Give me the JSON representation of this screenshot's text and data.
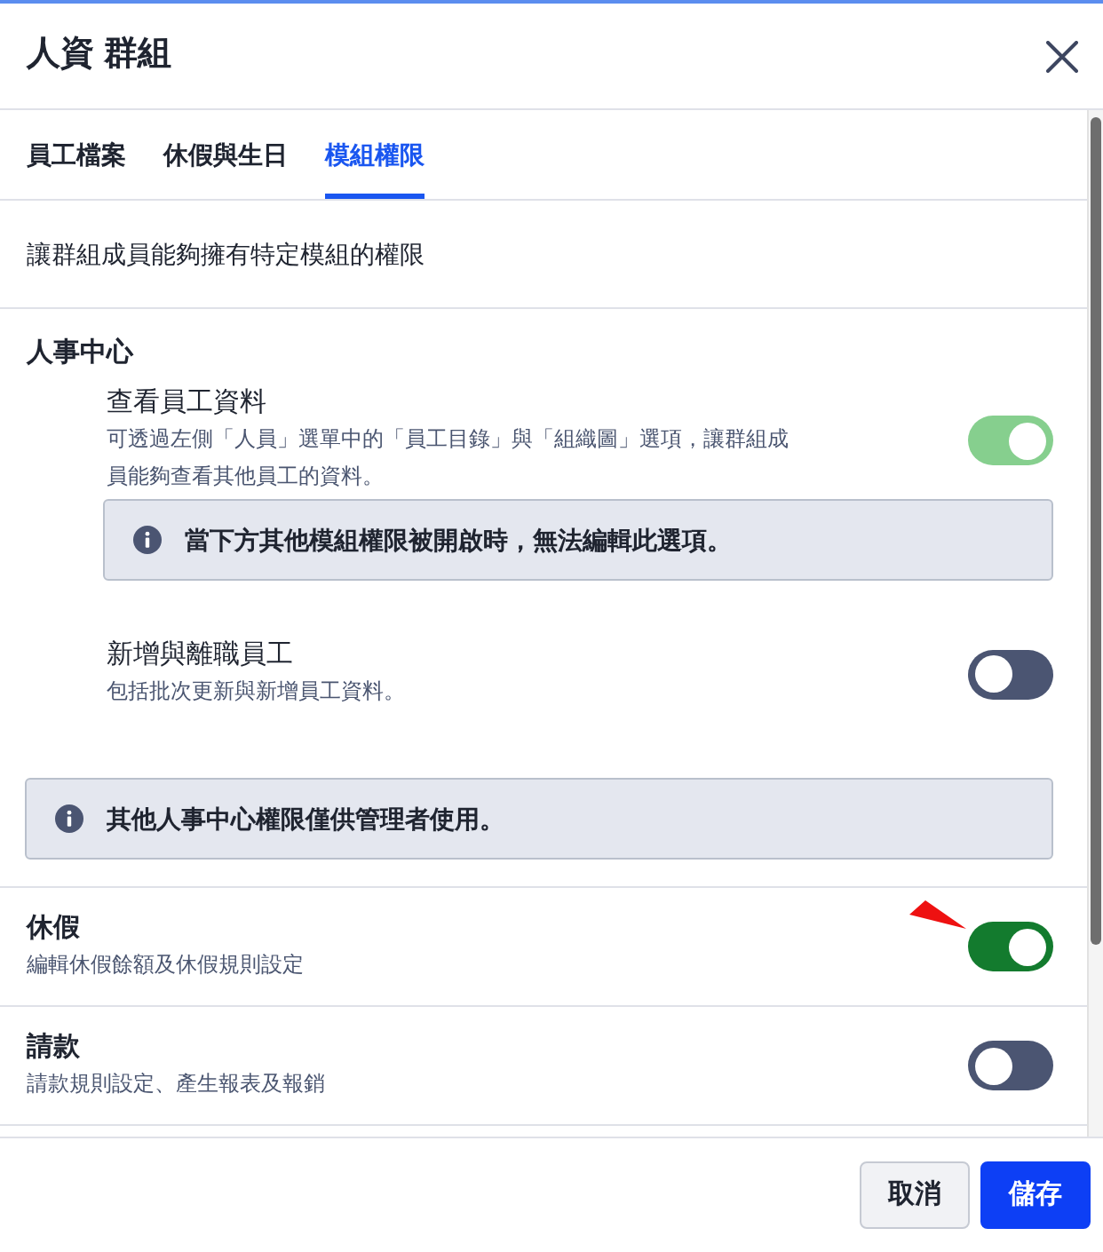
{
  "dialog": {
    "title": "人資 群組"
  },
  "tabs": [
    {
      "label": "員工檔案",
      "selected": false
    },
    {
      "label": "休假與生日",
      "selected": false
    },
    {
      "label": "模組權限",
      "selected": true
    }
  ],
  "intro": "讓群組成員能夠擁有特定模組的權限",
  "sections": [
    {
      "kind": "group",
      "title": "人事中心",
      "permissions": [
        {
          "title": "查看員工資料",
          "description": "可透過左側「人員」選單中的「員工目錄」與「組織圖」選項，讓群組成員能夠查看其他員工的資料。",
          "on": true,
          "disabled": true,
          "note": "當下方其他模組權限被開啟時，無法編輯此選項。"
        },
        {
          "title": "新增與離職員工",
          "description": "包括批次更新與新增員工資料。",
          "on": false,
          "disabled": false
        }
      ],
      "note": "其他人事中心權限僅供管理者使用。"
    },
    {
      "kind": "module",
      "title": "休假",
      "description": "編輯休假餘額及休假規則設定",
      "on": true,
      "disabled": false,
      "pointed": true
    },
    {
      "kind": "module",
      "title": "請款",
      "description": "請款規則設定、產生報表及報銷",
      "on": false,
      "disabled": false,
      "pointed": false
    }
  ],
  "footer": {
    "buttons": [
      {
        "label": "取消",
        "kind": "secondary"
      },
      {
        "label": "儲存",
        "kind": "primary"
      }
    ]
  }
}
